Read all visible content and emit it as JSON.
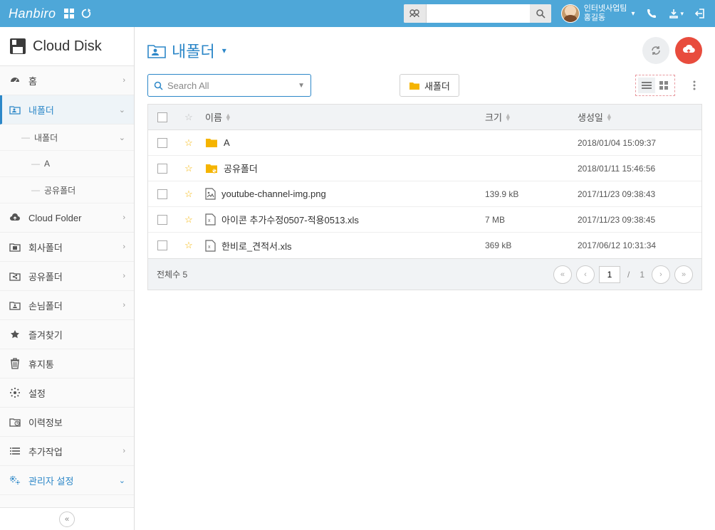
{
  "topbar": {
    "brand": "Hanbiro",
    "search_placeholder": "",
    "user_line1": "인터넷사업팀",
    "user_line2": "홍길동"
  },
  "sidebar": {
    "title": "Cloud Disk",
    "items": [
      {
        "label": "홈",
        "expand": "›"
      },
      {
        "label": "내폴더",
        "expand": "⌄"
      },
      {
        "label": "Cloud Folder",
        "expand": "›"
      },
      {
        "label": "회사폴더",
        "expand": "›"
      },
      {
        "label": "공유폴더",
        "expand": "›"
      },
      {
        "label": "손님폴더",
        "expand": "›"
      },
      {
        "label": "즐겨찾기"
      },
      {
        "label": "휴지통"
      },
      {
        "label": "설정"
      },
      {
        "label": "이력정보"
      },
      {
        "label": "추가작업",
        "expand": "›"
      },
      {
        "label": "관리자 설정",
        "expand": "⌄"
      }
    ],
    "subs": [
      {
        "label": "내폴더",
        "expand": "⌄"
      },
      {
        "label": "A"
      },
      {
        "label": "공유폴더"
      }
    ]
  },
  "main": {
    "title": "내폴더",
    "search_all": "Search All",
    "new_folder": "새폴더"
  },
  "table": {
    "headers": {
      "name": "이름",
      "size": "크기",
      "created": "생성일"
    },
    "rows": [
      {
        "name": "A",
        "kind": "folder",
        "size": "",
        "created": "2018/01/04 15:09:37"
      },
      {
        "name": "공유폴더",
        "kind": "sharefolder",
        "size": "",
        "created": "2018/01/11 15:46:56"
      },
      {
        "name": "youtube-channel-img.png",
        "kind": "image",
        "size": "139.9 kB",
        "created": "2017/11/23 09:38:43"
      },
      {
        "name": "아이콘 추가수정0507-적용0513.xls",
        "kind": "xls",
        "size": "7 MB",
        "created": "2017/11/23 09:38:45"
      },
      {
        "name": "한비로_견적서.xls",
        "kind": "xls",
        "size": "369 kB",
        "created": "2017/06/12 10:31:34"
      }
    ]
  },
  "footer": {
    "total_label": "전체수",
    "total": "5",
    "page": "1",
    "pages": "1"
  }
}
